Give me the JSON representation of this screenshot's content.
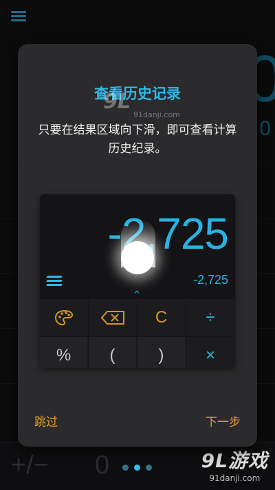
{
  "background": {
    "big_digit": "0",
    "small_digit": "0",
    "bottom_keys": [
      "+/−",
      "0",
      "."
    ]
  },
  "watermark": {
    "logo": "9L游戏",
    "url": "91danji.com"
  },
  "dialog": {
    "title": "查看历史记录",
    "description": "只要在结果区域向下滑，即可查看计算历史纪录。",
    "skip_label": "跳过",
    "next_label": "下一步"
  },
  "preview": {
    "main_value": "-2,725",
    "sub_value": "-2,725",
    "caret": "^",
    "keys_row1": [
      "palette-icon",
      "backspace-icon",
      "C",
      "÷"
    ],
    "keys_row2": [
      "%",
      "(",
      ")",
      "×"
    ]
  },
  "pager": {
    "count": 3,
    "active_index": 1
  },
  "colors": {
    "accent_blue": "#2fb8e3",
    "accent_orange": "#e4a021"
  }
}
